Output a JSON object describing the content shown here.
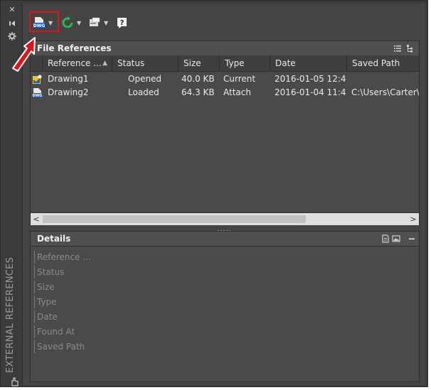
{
  "palette": {
    "frame_bg": "#3b3b3b",
    "panel_bg": "#4a4a4a",
    "highlight": "#e0121d",
    "refresh_green": "#2fb34a"
  },
  "side": {
    "vertical_title": "EXTERNAL REFERENCES"
  },
  "toolbar": {
    "buttons": [
      {
        "icon": "attach-dwg-icon",
        "badge": "DWG",
        "highlighted": true
      },
      {
        "icon": "refresh-icon"
      },
      {
        "icon": "change-path-icon"
      },
      {
        "icon": "help-icon"
      }
    ]
  },
  "file_references": {
    "title": "File References",
    "columns": [
      "Reference ...",
      "Status",
      "Size",
      "Type",
      "Date",
      "Saved Path"
    ],
    "sort_column": "Reference ...",
    "rows": [
      {
        "name": "Drawing1",
        "status": "Opened",
        "size": "40.0 KB",
        "type": "Current",
        "date": "2016-01-05 12:4...",
        "path": "",
        "icon": "current-drawing-icon"
      },
      {
        "name": "Drawing2",
        "status": "Loaded",
        "size": "64.3 KB",
        "type": "Attach",
        "date": "2016-01-04 11:4...",
        "path": "C:\\Users\\Carter\\D",
        "icon": "dwg-file-icon"
      }
    ]
  },
  "details": {
    "title": "Details",
    "fields": [
      "Reference ...",
      "Status",
      "Size",
      "Type",
      "Date",
      "Found At",
      "Saved Path"
    ]
  }
}
